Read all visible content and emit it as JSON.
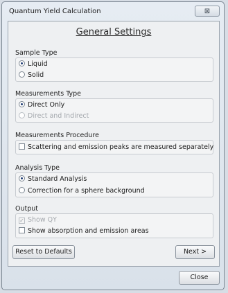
{
  "window": {
    "title": "Quantum Yield Calculation",
    "close_glyph": "⊠"
  },
  "heading": "General Settings",
  "sample_type": {
    "title": "Sample Type",
    "options": [
      {
        "label": "Liquid",
        "checked": true
      },
      {
        "label": "Solid",
        "checked": false
      }
    ]
  },
  "measurements_type": {
    "title": "Measurements Type",
    "options": [
      {
        "label": "Direct Only",
        "checked": true
      },
      {
        "label": "Direct and Indirect",
        "checked": false,
        "disabled": true
      }
    ]
  },
  "measurements_procedure": {
    "title": "Measurements Procedure",
    "option": {
      "label": "Scattering and emission peaks are measured separately",
      "checked": false
    }
  },
  "analysis_type": {
    "title": "Analysis Type",
    "options": [
      {
        "label": "Standard Analysis",
        "checked": true
      },
      {
        "label": "Correction for a sphere background",
        "checked": false
      }
    ]
  },
  "output": {
    "title": "Output",
    "options": [
      {
        "label": "Show QY",
        "checked": true,
        "disabled": true
      },
      {
        "label": "Show absorption and emission areas",
        "checked": false
      }
    ]
  },
  "buttons": {
    "reset": "Reset to Defaults",
    "next": "Next >",
    "close": "Close"
  }
}
